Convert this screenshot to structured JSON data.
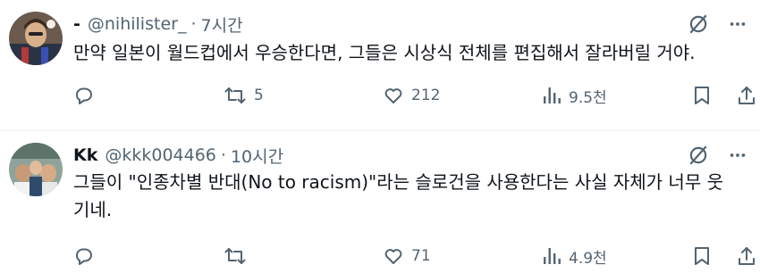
{
  "tweets": [
    {
      "display_name": "-",
      "handle": "@nihilister_",
      "separator": "·",
      "time": "7시간",
      "text": "만약 일본이 월드컵에서 우승한다면, 그들은 시상식 전체를 편집해서 잘라버릴 거야.",
      "reply_count": "",
      "retweet_count": "5",
      "like_count": "212",
      "view_count": "9.5천",
      "avatar_icon": "avatar-photo"
    },
    {
      "display_name": "Kk",
      "handle": "@kkk004466",
      "separator": "·",
      "time": "10시간",
      "text": "그들이 \"인종차별 반대(No to racism)\"라는 슬로건을 사용한다는 사실 자체가 너무 웃기네.",
      "reply_count": "",
      "retweet_count": "",
      "like_count": "71",
      "view_count": "4.9천",
      "avatar_icon": "avatar-photo"
    }
  ],
  "colors": {
    "text_primary": "#0f1419",
    "text_secondary": "#536471",
    "divider": "#eff3f4",
    "background": "#ffffff"
  },
  "icons": {
    "grok": "grok-icon",
    "more": "more-icon",
    "reply": "reply-icon",
    "retweet": "retweet-icon",
    "like": "like-icon",
    "views": "views-icon",
    "bookmark": "bookmark-icon",
    "share": "share-icon"
  }
}
